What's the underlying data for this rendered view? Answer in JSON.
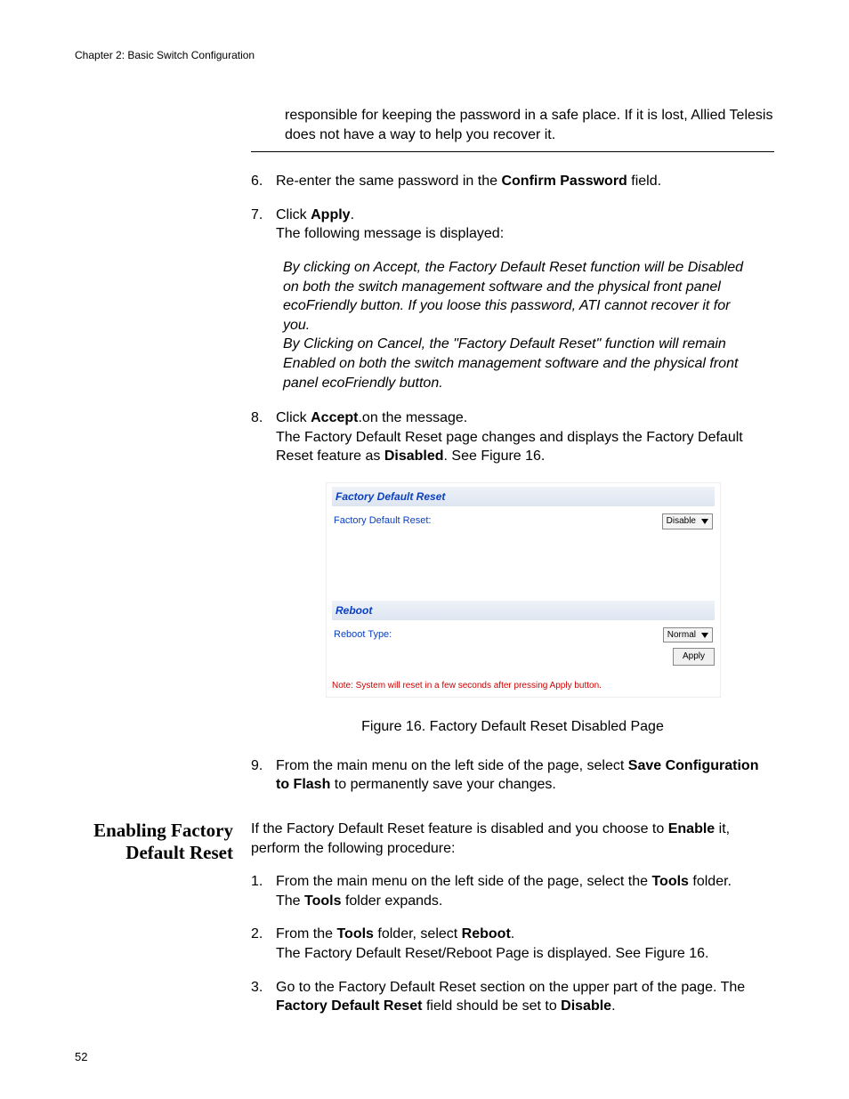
{
  "chapterHeader": "Chapter 2: Basic Switch Configuration",
  "pageNumber": "52",
  "noteTail": "responsible for keeping the password in a safe place. If it is lost, Allied Telesis does not have a way to help you recover it.",
  "step6": {
    "num": "6.",
    "pre": "Re-enter the same password in the ",
    "bold": "Confirm Password",
    "post": " field."
  },
  "step7": {
    "num": "7.",
    "line1a": "Click ",
    "line1b": "Apply",
    "line1c": ".",
    "line2": "The following message is displayed:"
  },
  "acceptMsg": {
    "p1": "By clicking on Accept, the Factory Default Reset function will be Disabled on both the switch management software and the physical front panel ecoFriendly button. If you loose this password, ATI cannot recover it for you.",
    "p2": "By Clicking on Cancel, the \"Factory Default Reset\" function will remain Enabled on both the switch management software and the physical front panel ecoFriendly button."
  },
  "step8": {
    "num": "8.",
    "line1a": "Click ",
    "line1b": "Accept",
    "line1c": ".on the message.",
    "line2a": "The Factory Default Reset page changes and displays the Factory Default Reset feature as ",
    "line2b": "Disabled",
    "line2c": ". See Figure 16."
  },
  "figure": {
    "header1": "Factory Default Reset",
    "row1Label": "Factory Default Reset:",
    "row1Value": "Disable",
    "header2": "Reboot",
    "row2Label": "Reboot Type:",
    "row2Value": "Normal",
    "applyLabel": "Apply",
    "note": "Note: System will reset in a few seconds after pressing Apply button.",
    "caption": "Figure 16. Factory Default Reset Disabled Page"
  },
  "step9": {
    "num": "9.",
    "a": "From the main menu on the left side of the page, select ",
    "b": "Save Configuration to Flash",
    "c": " to permanently save your changes."
  },
  "sideHeading": {
    "l1": "Enabling Factory",
    "l2": "Default Reset"
  },
  "intro2": {
    "a": "If the Factory Default Reset feature is disabled and you choose to ",
    "b": "Enable",
    "c": " it, perform the following procedure:"
  },
  "s2step1": {
    "num": "1.",
    "a": "From the main menu on the left side of the page, select the ",
    "b": "Tools",
    "c": " folder.",
    "d": "The ",
    "e": "Tools",
    "f": " folder expands."
  },
  "s2step2": {
    "num": "2.",
    "a": "From the ",
    "b": "Tools",
    "c": " folder, select ",
    "d": "Reboot",
    "e": ".",
    "f": "The Factory Default Reset/Reboot Page is displayed. See Figure 16."
  },
  "s2step3": {
    "num": "3.",
    "a": "Go to the Factory Default Reset section on the upper part of the page. The ",
    "b": "Factory Default Reset",
    "c": " field should be set to ",
    "d": "Disable",
    "e": "."
  }
}
